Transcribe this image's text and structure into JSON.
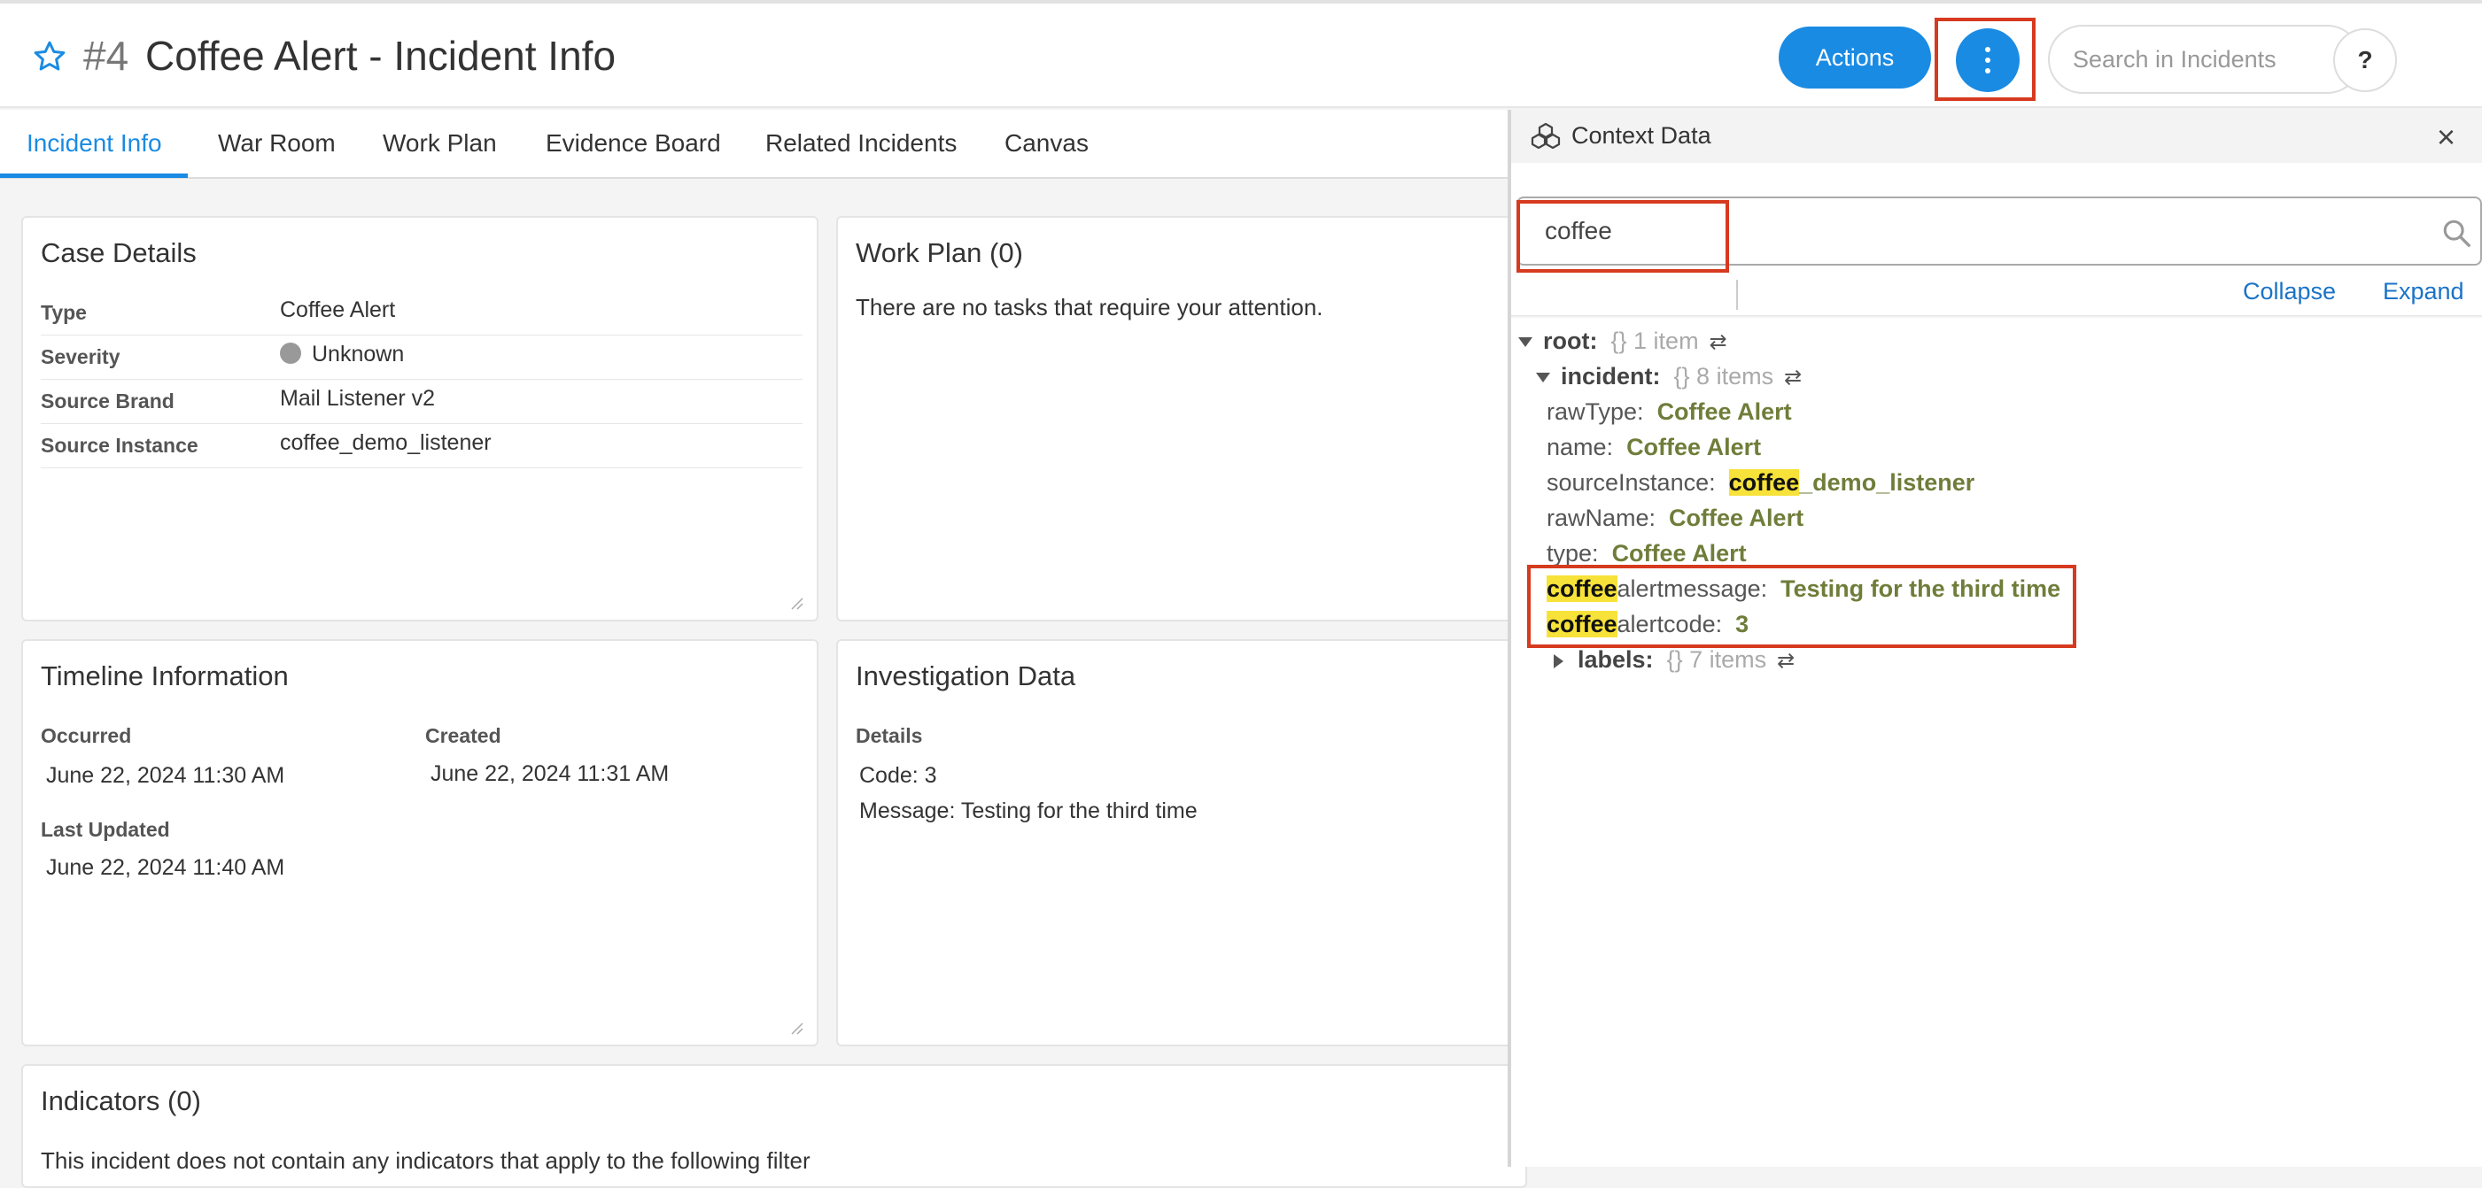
{
  "header": {
    "incident_number": "#4",
    "title": "Coffee Alert - Incident Info",
    "actions_label": "Actions",
    "search_placeholder": "Search in Incidents",
    "help_label": "?"
  },
  "tabs": [
    {
      "label": "Incident Info",
      "active": true
    },
    {
      "label": "War Room"
    },
    {
      "label": "Work Plan"
    },
    {
      "label": "Evidence Board"
    },
    {
      "label": "Related Incidents"
    },
    {
      "label": "Canvas"
    }
  ],
  "case_details": {
    "title": "Case Details",
    "rows": [
      {
        "label": "Type",
        "value": "Coffee Alert"
      },
      {
        "label": "Severity",
        "value": "Unknown",
        "icon": "bomb-icon"
      },
      {
        "label": "Source Brand",
        "value": "Mail Listener v2"
      },
      {
        "label": "Source Instance",
        "value": "coffee_demo_listener"
      }
    ]
  },
  "work_plan": {
    "title": "Work Plan (0)",
    "message": "There are no tasks that require your attention."
  },
  "timeline": {
    "title": "Timeline Information",
    "occurred_label": "Occurred",
    "occurred_value": "June 22, 2024 11:30 AM",
    "created_label": "Created",
    "created_value": "June 22, 2024 11:31 AM",
    "updated_label": "Last Updated",
    "updated_value": "June 22, 2024 11:40 AM"
  },
  "investigation": {
    "title": "Investigation Data",
    "details_label": "Details",
    "lines": [
      "Code: 3",
      "Message: Testing for the third time"
    ]
  },
  "indicators": {
    "title": "Indicators (0)",
    "message": "This incident does not contain any indicators that apply to the following filter"
  },
  "context_panel": {
    "title": "Context Data",
    "close_label": "×",
    "search_value": "coffee",
    "collapse_label": "Collapse",
    "expand_label": "Expand",
    "tree": {
      "root_key": "root:",
      "root_meta": "{} 1 item",
      "incident_key": "incident:",
      "incident_meta": "{} 8 items",
      "rows": [
        {
          "key": "rawType:",
          "value": "Coffee Alert"
        },
        {
          "key": "name:",
          "value": "Coffee Alert"
        },
        {
          "key": "sourceInstance:",
          "value_highlight": "coffee",
          "value_rest": "_demo_listener"
        },
        {
          "key": "rawName:",
          "value": "Coffee Alert"
        },
        {
          "key": "type:",
          "value": "Coffee Alert"
        },
        {
          "key_highlight": "coffee",
          "key_rest": "alertmessage:",
          "value": "Testing for the third time"
        },
        {
          "key_highlight": "coffee",
          "key_rest": "alertcode:",
          "value": "3"
        }
      ],
      "labels_key": "labels:",
      "labels_meta": "{} 7 items"
    }
  },
  "colors": {
    "accent": "#1a8be3",
    "highlight": "#f7e23a",
    "annotation_red": "#d63a1f",
    "value_olive": "#6f7d3a"
  }
}
